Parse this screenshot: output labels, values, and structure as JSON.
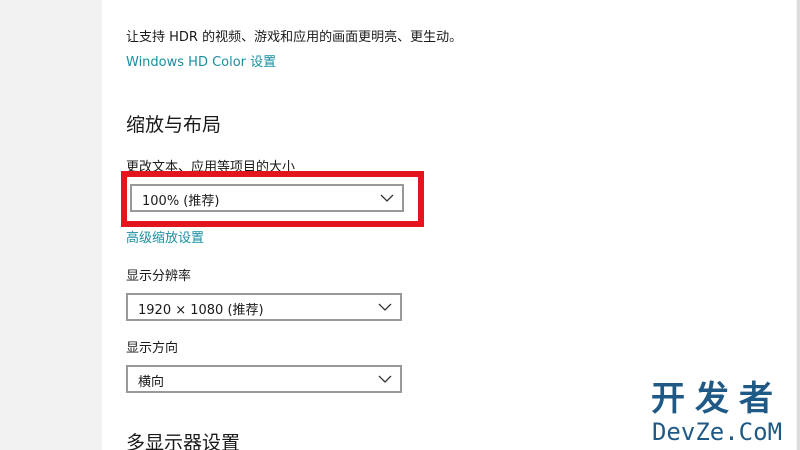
{
  "hdr": {
    "description": "让支持 HDR 的视频、游戏和应用的画面更明亮、更生动。",
    "link": "Windows HD Color 设置"
  },
  "scale_layout": {
    "title": "缩放与布局",
    "text_size_label": "更改文本、应用等项目的大小",
    "text_size_value": "100% (推荐)",
    "advanced_link": "高级缩放设置"
  },
  "resolution": {
    "label": "显示分辨率",
    "value": "1920 × 1080 (推荐)"
  },
  "orientation": {
    "label": "显示方向",
    "value": "横向"
  },
  "multi_display": {
    "title": "多显示器设置"
  },
  "watermark": {
    "chinese": "开发者",
    "english": "DevZe.CoM"
  },
  "colors": {
    "link": "#1a8ea0",
    "highlight": "#e3161e",
    "watermark": "#1f5a86"
  },
  "icons": {
    "dropdown": "chevron-down-icon"
  }
}
